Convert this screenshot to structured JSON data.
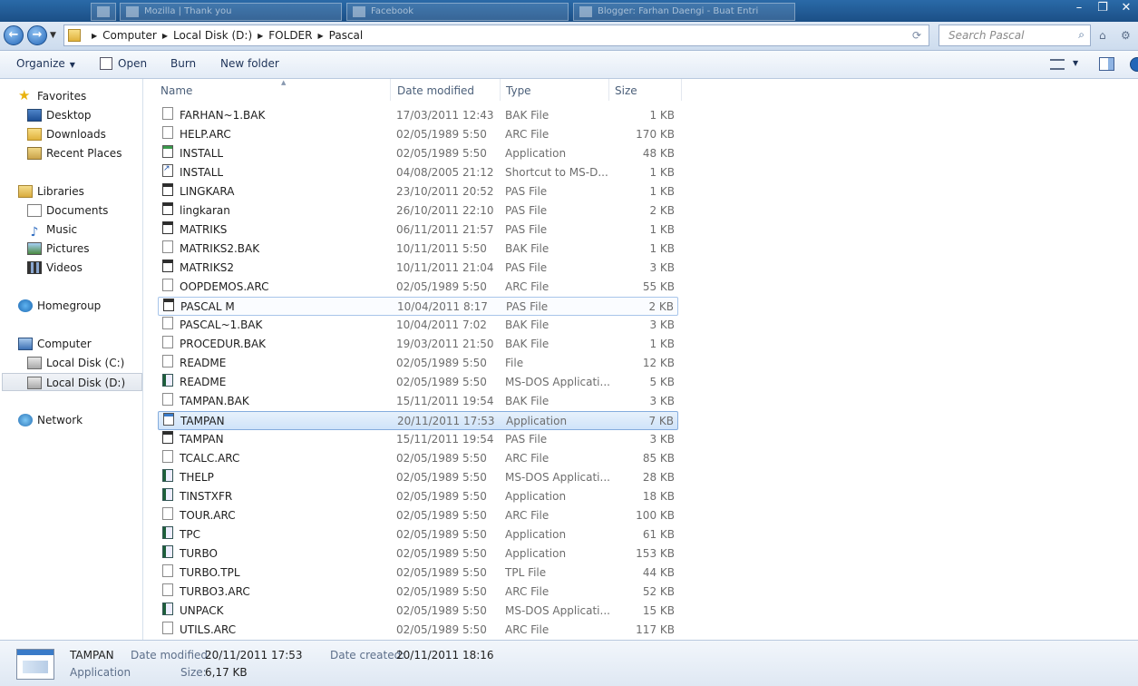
{
  "window": {
    "bg_tabs": [
      "Mozilla | Thank you",
      "Facebook",
      "Blogger: Farhan Daengi - Buat Entri"
    ]
  },
  "address": {
    "breadcrumbs": [
      "Computer",
      "Local Disk (D:)",
      "FOLDER",
      "Pascal"
    ],
    "search_placeholder": "Search Pascal"
  },
  "toolbar": {
    "organize": "Organize",
    "open": "Open",
    "burn": "Burn",
    "new_folder": "New folder"
  },
  "nav": {
    "favorites": "Favorites",
    "desktop": "Desktop",
    "downloads": "Downloads",
    "recent": "Recent Places",
    "libraries": "Libraries",
    "documents": "Documents",
    "music": "Music",
    "pictures": "Pictures",
    "videos": "Videos",
    "homegroup": "Homegroup",
    "computer": "Computer",
    "local_c": "Local Disk (C:)",
    "local_d": "Local Disk (D:)",
    "network": "Network"
  },
  "columns": {
    "name": "Name",
    "date": "Date modified",
    "type": "Type",
    "size": "Size"
  },
  "files": [
    {
      "name": "FARHAN~1.BAK",
      "date": "17/03/2011 12:43",
      "type": "BAK File",
      "size": "1 KB",
      "icon": "blank"
    },
    {
      "name": "HELP.ARC",
      "date": "02/05/1989 5:50",
      "type": "ARC File",
      "size": "170 KB",
      "icon": "blank"
    },
    {
      "name": "INSTALL",
      "date": "02/05/1989 5:50",
      "type": "Application",
      "size": "48 KB",
      "icon": "inst"
    },
    {
      "name": "INSTALL",
      "date": "04/08/2005 21:12",
      "type": "Shortcut to MS-D...",
      "size": "1 KB",
      "icon": "short"
    },
    {
      "name": "LINGKARA",
      "date": "23/10/2011 20:52",
      "type": "PAS File",
      "size": "1 KB",
      "icon": "pas"
    },
    {
      "name": "lingkaran",
      "date": "26/10/2011 22:10",
      "type": "PAS File",
      "size": "2 KB",
      "icon": "pas"
    },
    {
      "name": "MATRIKS",
      "date": "06/11/2011 21:57",
      "type": "PAS File",
      "size": "1 KB",
      "icon": "pas"
    },
    {
      "name": "MATRIKS2.BAK",
      "date": "10/11/2011 5:50",
      "type": "BAK File",
      "size": "1 KB",
      "icon": "blank"
    },
    {
      "name": "MATRIKS2",
      "date": "10/11/2011 21:04",
      "type": "PAS File",
      "size": "3 KB",
      "icon": "pas"
    },
    {
      "name": "OOPDEMOS.ARC",
      "date": "02/05/1989 5:50",
      "type": "ARC File",
      "size": "55 KB",
      "icon": "blank"
    },
    {
      "name": "PASCAL M",
      "date": "10/04/2011 8:17",
      "type": "PAS File",
      "size": "2 KB",
      "icon": "pas"
    },
    {
      "name": "PASCAL~1.BAK",
      "date": "10/04/2011 7:02",
      "type": "BAK File",
      "size": "3 KB",
      "icon": "blank"
    },
    {
      "name": "PROCEDUR.BAK",
      "date": "19/03/2011 21:50",
      "type": "BAK File",
      "size": "1 KB",
      "icon": "blank"
    },
    {
      "name": "README",
      "date": "02/05/1989 5:50",
      "type": "File",
      "size": "12 KB",
      "icon": "blank"
    },
    {
      "name": "README",
      "date": "02/05/1989 5:50",
      "type": "MS-DOS Applicati...",
      "size": "5 KB",
      "icon": "dos"
    },
    {
      "name": "TAMPAN.BAK",
      "date": "15/11/2011 19:54",
      "type": "BAK File",
      "size": "3 KB",
      "icon": "blank"
    },
    {
      "name": "TAMPAN",
      "date": "20/11/2011 17:53",
      "type": "Application",
      "size": "7 KB",
      "icon": "app"
    },
    {
      "name": "TAMPAN",
      "date": "15/11/2011 19:54",
      "type": "PAS File",
      "size": "3 KB",
      "icon": "pas"
    },
    {
      "name": "TCALC.ARC",
      "date": "02/05/1989 5:50",
      "type": "ARC File",
      "size": "85 KB",
      "icon": "blank"
    },
    {
      "name": "THELP",
      "date": "02/05/1989 5:50",
      "type": "MS-DOS Applicati...",
      "size": "28 KB",
      "icon": "dos"
    },
    {
      "name": "TINSTXFR",
      "date": "02/05/1989 5:50",
      "type": "Application",
      "size": "18 KB",
      "icon": "dos"
    },
    {
      "name": "TOUR.ARC",
      "date": "02/05/1989 5:50",
      "type": "ARC File",
      "size": "100 KB",
      "icon": "blank"
    },
    {
      "name": "TPC",
      "date": "02/05/1989 5:50",
      "type": "Application",
      "size": "61 KB",
      "icon": "dos"
    },
    {
      "name": "TURBO",
      "date": "02/05/1989 5:50",
      "type": "Application",
      "size": "153 KB",
      "icon": "dos"
    },
    {
      "name": "TURBO.TPL",
      "date": "02/05/1989 5:50",
      "type": "TPL File",
      "size": "44 KB",
      "icon": "blank"
    },
    {
      "name": "TURBO3.ARC",
      "date": "02/05/1989 5:50",
      "type": "ARC File",
      "size": "52 KB",
      "icon": "blank"
    },
    {
      "name": "UNPACK",
      "date": "02/05/1989 5:50",
      "type": "MS-DOS Applicati...",
      "size": "15 KB",
      "icon": "dos"
    },
    {
      "name": "UTILS.ARC",
      "date": "02/05/1989 5:50",
      "type": "ARC File",
      "size": "117 KB",
      "icon": "blank"
    }
  ],
  "details": {
    "name": "TAMPAN",
    "kind": "Application",
    "modified_label": "Date modified:",
    "modified": "20/11/2011 17:53",
    "created_label": "Date created:",
    "created": "20/11/2011 18:16",
    "size_label": "Size:",
    "size": "6,17 KB"
  }
}
